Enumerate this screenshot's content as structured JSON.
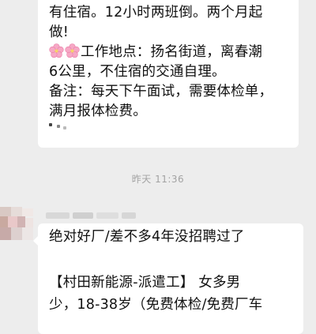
{
  "messages": {
    "top": {
      "lines": [
        "有住宿。12小时两班倒。两个月起",
        "做!",
        "工作地点：扬名街道，离春潮",
        "6公里，不住宿的交通自理。",
        "备注：每天下午面试，需要体检单，",
        "满月报体检费。"
      ],
      "emoji_icon": "cherry-blossom-icon"
    },
    "timestamp": "昨天 11:36",
    "bottom": {
      "lines": [
        "绝对好厂/差不多4年没招聘过了",
        "【村田新能源-派遣工】 女多男",
        "少，18-38岁（免费体检/免费厂车"
      ]
    }
  },
  "colors": {
    "background": "#ededed",
    "bubble": "#ffffff",
    "timestamp": "#a3a3a3"
  }
}
